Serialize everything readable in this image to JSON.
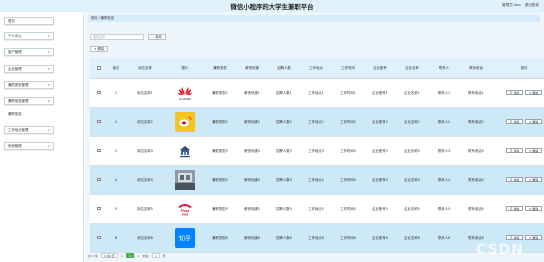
{
  "header": {
    "title": "微信小程序的大学生兼职平台",
    "links": [
      "管理员 abo",
      "退出登录"
    ]
  },
  "sidebar": {
    "items": [
      {
        "label": "首页"
      },
      {
        "label": "个人中心",
        "caret": "∨"
      },
      {
        "label": "用户管理",
        "caret": "∨"
      },
      {
        "label": "企业管理",
        "caret": "∨"
      },
      {
        "label": "兼职类型管理",
        "caret": "∨"
      },
      {
        "label": "兼职信息管理",
        "caret": "∧"
      },
      {
        "label": "工作地点管理",
        "caret": "∨"
      },
      {
        "label": "系统管理",
        "caret": "∨"
      }
    ],
    "sub_item": "兼职信息"
  },
  "breadcrumb": "首页 / 兼职信息",
  "toolbar": {
    "search_placeholder": "兼职名称",
    "search_label": "查询",
    "delete_label": "删除"
  },
  "table": {
    "headers": [
      "",
      "索引",
      "岗位名称",
      "图片",
      "兼职类型",
      "薪资待遇",
      "招聘人数",
      "工作地点",
      "工作时间",
      "企业账号",
      "企业名称",
      "联系人",
      "联系电话",
      "操作"
    ],
    "rows": [
      {
        "index": "1",
        "cells": [
          "岗位名称1",
          "兼职类型1",
          "薪资待遇1",
          "招聘人数1",
          "工作地点1",
          "工作时间1",
          "企业账号1",
          "企业名称1",
          "联系人1",
          "联系电话1"
        ],
        "logo": "huawei",
        "logo_text": "HUAWEI"
      },
      {
        "index": "2",
        "cells": [
          "岗位名称2",
          "兼职类型2",
          "薪资待遇2",
          "招聘人数2",
          "工作地点2",
          "工作时间2",
          "企业账号2",
          "企业名称2",
          "联系人2",
          "联系电话2"
        ],
        "logo": "weibo",
        "logo_text": ""
      },
      {
        "index": "3",
        "cells": [
          "岗位名称3",
          "兼职类型3",
          "薪资待遇3",
          "招聘人数3",
          "工作地点3",
          "工作时间3",
          "企业账号3",
          "企业名称3",
          "联系人3",
          "联系电话3"
        ],
        "logo": "building",
        "logo_text": ""
      },
      {
        "index": "4",
        "cells": [
          "岗位名称4",
          "兼职类型4",
          "薪资待遇4",
          "招聘人数4",
          "工作地点4",
          "工作时间4",
          "企业账号4",
          "企业名称4",
          "联系人4",
          "联系电话4"
        ],
        "logo": "photo",
        "logo_text": ""
      },
      {
        "index": "5",
        "cells": [
          "岗位名称5",
          "兼职类型5",
          "薪资待遇5",
          "招聘人数5",
          "工作地点5",
          "工作时间5",
          "企业账号5",
          "企业名称5",
          "联系人5",
          "联系电话5"
        ],
        "logo": "pizzahut",
        "logo_text": "Pizza Hut"
      },
      {
        "index": "6",
        "cells": [
          "岗位名称6",
          "兼职类型6",
          "薪资待遇6",
          "招聘人数6",
          "工作地点6",
          "工作时间6",
          "企业账号6",
          "企业名称6",
          "联系人6",
          "联系电话6"
        ],
        "logo": "zhihu",
        "logo_text": "知乎"
      }
    ],
    "action_edit": "详情",
    "action_delete": "删除"
  },
  "pagination": {
    "total": "共 6 条",
    "page_size": "10条/页",
    "prev": "<",
    "current": "1",
    "next": ">",
    "goto_label": "前往",
    "goto_value": "1",
    "page_unit": "页"
  },
  "watermark": "CSDN",
  "colors": {
    "header_bg": "#dff2fb",
    "row_alt": "#cde8f7",
    "accent": "#4caf50"
  }
}
